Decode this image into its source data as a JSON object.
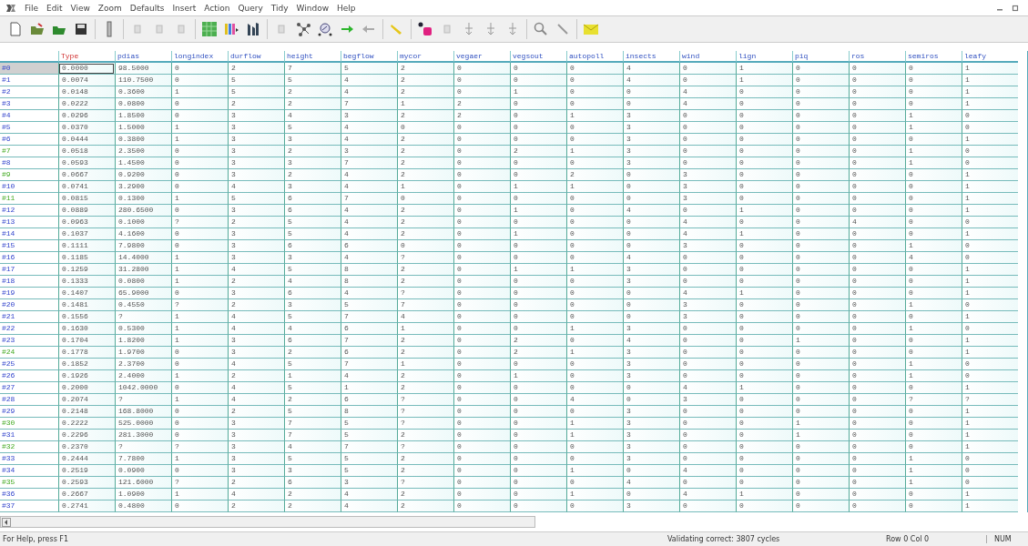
{
  "menu": [
    "File",
    "Edit",
    "View",
    "Zoom",
    "Defaults",
    "Insert",
    "Action",
    "Query",
    "Tidy",
    "Window",
    "Help"
  ],
  "table": {
    "columns": [
      {
        "label": "Type",
        "kind": "class"
      },
      {
        "label": "pdias",
        "kind": "variable"
      },
      {
        "label": "longindex",
        "kind": "variable"
      },
      {
        "label": "durflow",
        "kind": "variable"
      },
      {
        "label": "height",
        "kind": "variable"
      },
      {
        "label": "begflow",
        "kind": "variable"
      },
      {
        "label": "mycor",
        "kind": "variable"
      },
      {
        "label": "vegaer",
        "kind": "variable"
      },
      {
        "label": "vegsout",
        "kind": "variable"
      },
      {
        "label": "autopoll",
        "kind": "variable"
      },
      {
        "label": "insects",
        "kind": "variable"
      },
      {
        "label": "wind",
        "kind": "variable"
      },
      {
        "label": "lign",
        "kind": "variable"
      },
      {
        "label": "piq",
        "kind": "variable"
      },
      {
        "label": "ros",
        "kind": "variable"
      },
      {
        "label": "semiros",
        "kind": "variable"
      },
      {
        "label": "leafy",
        "kind": "variable"
      }
    ],
    "rows": [
      {
        "label": "#0",
        "kind": "primary",
        "selected": true,
        "cells": [
          "0.0000",
          "98.5000",
          "0",
          "2",
          "7",
          "5",
          "2",
          "0",
          "0",
          "0",
          "4",
          "0",
          "1",
          "0",
          "0",
          "0",
          "1"
        ]
      },
      {
        "label": "#1",
        "kind": "primary",
        "selected": false,
        "cells": [
          "0.0074",
          "110.7500",
          "0",
          "5",
          "5",
          "4",
          "2",
          "0",
          "0",
          "0",
          "4",
          "0",
          "1",
          "0",
          "0",
          "0",
          "1"
        ]
      },
      {
        "label": "#2",
        "kind": "primary",
        "selected": false,
        "cells": [
          "0.0148",
          "0.3600",
          "1",
          "5",
          "2",
          "4",
          "2",
          "0",
          "1",
          "0",
          "0",
          "4",
          "0",
          "0",
          "0",
          "0",
          "1"
        ]
      },
      {
        "label": "#3",
        "kind": "primary",
        "selected": false,
        "cells": [
          "0.0222",
          "0.0800",
          "0",
          "2",
          "2",
          "7",
          "1",
          "2",
          "0",
          "0",
          "0",
          "4",
          "0",
          "0",
          "0",
          "0",
          "1"
        ]
      },
      {
        "label": "#4",
        "kind": "primary",
        "selected": false,
        "cells": [
          "0.0296",
          "1.8500",
          "0",
          "3",
          "4",
          "3",
          "2",
          "2",
          "0",
          "1",
          "3",
          "0",
          "0",
          "0",
          "0",
          "1",
          "0"
        ]
      },
      {
        "label": "#5",
        "kind": "primary",
        "selected": false,
        "cells": [
          "0.0370",
          "1.5000",
          "1",
          "3",
          "5",
          "4",
          "0",
          "0",
          "0",
          "0",
          "3",
          "0",
          "0",
          "0",
          "0",
          "1",
          "0"
        ]
      },
      {
        "label": "#6",
        "kind": "primary",
        "selected": false,
        "cells": [
          "0.0444",
          "0.3800",
          "1",
          "3",
          "3",
          "4",
          "2",
          "0",
          "0",
          "0",
          "3",
          "0",
          "0",
          "0",
          "0",
          "0",
          "1"
        ]
      },
      {
        "label": "#7",
        "kind": "secondary",
        "selected": false,
        "cells": [
          "0.0518",
          "2.3500",
          "0",
          "3",
          "2",
          "3",
          "2",
          "0",
          "2",
          "1",
          "3",
          "0",
          "0",
          "0",
          "0",
          "1",
          "0"
        ]
      },
      {
        "label": "#8",
        "kind": "primary",
        "selected": false,
        "cells": [
          "0.0593",
          "1.4500",
          "0",
          "3",
          "3",
          "7",
          "2",
          "0",
          "0",
          "0",
          "3",
          "0",
          "0",
          "0",
          "0",
          "1",
          "0"
        ]
      },
      {
        "label": "#9",
        "kind": "secondary",
        "selected": false,
        "cells": [
          "0.0667",
          "0.9200",
          "0",
          "3",
          "2",
          "4",
          "2",
          "0",
          "0",
          "2",
          "0",
          "3",
          "0",
          "0",
          "0",
          "0",
          "1"
        ]
      },
      {
        "label": "#10",
        "kind": "primary",
        "selected": false,
        "cells": [
          "0.0741",
          "3.2900",
          "0",
          "4",
          "3",
          "4",
          "1",
          "0",
          "1",
          "1",
          "0",
          "3",
          "0",
          "0",
          "0",
          "0",
          "1"
        ]
      },
      {
        "label": "#11",
        "kind": "secondary",
        "selected": false,
        "cells": [
          "0.0815",
          "0.1300",
          "1",
          "5",
          "6",
          "7",
          "0",
          "0",
          "0",
          "0",
          "0",
          "3",
          "0",
          "0",
          "0",
          "0",
          "1"
        ]
      },
      {
        "label": "#12",
        "kind": "primary",
        "selected": false,
        "cells": [
          "0.0889",
          "280.6500",
          "0",
          "3",
          "6",
          "4",
          "2",
          "0",
          "1",
          "0",
          "4",
          "0",
          "1",
          "0",
          "0",
          "0",
          "1"
        ]
      },
      {
        "label": "#13",
        "kind": "primary",
        "selected": false,
        "cells": [
          "0.0963",
          "0.1000",
          "?",
          "2",
          "5",
          "4",
          "2",
          "0",
          "0",
          "0",
          "0",
          "4",
          "0",
          "0",
          "4",
          "0",
          "0"
        ]
      },
      {
        "label": "#14",
        "kind": "primary",
        "selected": false,
        "cells": [
          "0.1037",
          "4.1600",
          "0",
          "3",
          "5",
          "4",
          "2",
          "0",
          "1",
          "0",
          "0",
          "4",
          "1",
          "0",
          "0",
          "0",
          "1"
        ]
      },
      {
        "label": "#15",
        "kind": "primary",
        "selected": false,
        "cells": [
          "0.1111",
          "7.9800",
          "0",
          "3",
          "6",
          "6",
          "0",
          "0",
          "0",
          "0",
          "0",
          "3",
          "0",
          "0",
          "0",
          "1",
          "0"
        ]
      },
      {
        "label": "#16",
        "kind": "primary",
        "selected": false,
        "cells": [
          "0.1185",
          "14.4000",
          "1",
          "3",
          "3",
          "4",
          "?",
          "0",
          "0",
          "0",
          "4",
          "0",
          "0",
          "0",
          "0",
          "4",
          "0"
        ]
      },
      {
        "label": "#17",
        "kind": "primary",
        "selected": false,
        "cells": [
          "0.1259",
          "31.2800",
          "1",
          "4",
          "5",
          "8",
          "2",
          "0",
          "1",
          "1",
          "3",
          "0",
          "0",
          "0",
          "0",
          "0",
          "1"
        ]
      },
      {
        "label": "#18",
        "kind": "primary",
        "selected": false,
        "cells": [
          "0.1333",
          "0.0800",
          "1",
          "2",
          "4",
          "8",
          "2",
          "0",
          "0",
          "0",
          "3",
          "0",
          "0",
          "0",
          "0",
          "0",
          "1"
        ]
      },
      {
        "label": "#19",
        "kind": "primary",
        "selected": false,
        "cells": [
          "0.1407",
          "65.9000",
          "0",
          "3",
          "6",
          "4",
          "?",
          "0",
          "0",
          "0",
          "0",
          "4",
          "1",
          "0",
          "0",
          "0",
          "1"
        ]
      },
      {
        "label": "#20",
        "kind": "primary",
        "selected": false,
        "cells": [
          "0.1481",
          "0.4550",
          "?",
          "2",
          "3",
          "5",
          "7",
          "0",
          "0",
          "0",
          "0",
          "3",
          "0",
          "0",
          "0",
          "1",
          "0"
        ]
      },
      {
        "label": "#21",
        "kind": "primary",
        "selected": false,
        "cells": [
          "0.1556",
          "?",
          "1",
          "4",
          "5",
          "7",
          "4",
          "0",
          "0",
          "0",
          "0",
          "3",
          "0",
          "0",
          "0",
          "0",
          "1"
        ]
      },
      {
        "label": "#22",
        "kind": "primary",
        "selected": false,
        "cells": [
          "0.1630",
          "0.5300",
          "1",
          "4",
          "4",
          "6",
          "1",
          "0",
          "0",
          "1",
          "3",
          "0",
          "0",
          "0",
          "0",
          "1",
          "0"
        ]
      },
      {
        "label": "#23",
        "kind": "primary",
        "selected": false,
        "cells": [
          "0.1704",
          "1.8200",
          "1",
          "3",
          "6",
          "7",
          "2",
          "0",
          "2",
          "0",
          "4",
          "0",
          "0",
          "1",
          "0",
          "0",
          "1"
        ]
      },
      {
        "label": "#24",
        "kind": "secondary",
        "selected": false,
        "cells": [
          "0.1778",
          "1.9700",
          "0",
          "3",
          "2",
          "6",
          "2",
          "0",
          "2",
          "1",
          "3",
          "0",
          "0",
          "0",
          "0",
          "0",
          "1"
        ]
      },
      {
        "label": "#25",
        "kind": "primary",
        "selected": false,
        "cells": [
          "0.1852",
          "2.3700",
          "0",
          "4",
          "5",
          "7",
          "1",
          "0",
          "0",
          "0",
          "3",
          "0",
          "0",
          "0",
          "0",
          "1",
          "0"
        ]
      },
      {
        "label": "#26",
        "kind": "primary",
        "selected": false,
        "cells": [
          "0.1926",
          "2.4000",
          "1",
          "2",
          "1",
          "4",
          "2",
          "0",
          "1",
          "0",
          "3",
          "0",
          "0",
          "0",
          "0",
          "1",
          "0"
        ]
      },
      {
        "label": "#27",
        "kind": "primary",
        "selected": false,
        "cells": [
          "0.2000",
          "1042.0000",
          "0",
          "4",
          "5",
          "1",
          "2",
          "0",
          "0",
          "0",
          "0",
          "4",
          "1",
          "0",
          "0",
          "0",
          "1"
        ]
      },
      {
        "label": "#28",
        "kind": "primary",
        "selected": false,
        "cells": [
          "0.2074",
          "?",
          "1",
          "4",
          "2",
          "6",
          "?",
          "0",
          "0",
          "4",
          "0",
          "3",
          "0",
          "0",
          "0",
          "?",
          "?"
        ]
      },
      {
        "label": "#29",
        "kind": "primary",
        "selected": false,
        "cells": [
          "0.2148",
          "168.8000",
          "0",
          "2",
          "5",
          "8",
          "?",
          "0",
          "0",
          "0",
          "3",
          "0",
          "0",
          "0",
          "0",
          "0",
          "1"
        ]
      },
      {
        "label": "#30",
        "kind": "secondary",
        "selected": false,
        "cells": [
          "0.2222",
          "525.0000",
          "0",
          "3",
          "7",
          "5",
          "?",
          "0",
          "0",
          "1",
          "3",
          "0",
          "0",
          "1",
          "0",
          "0",
          "1"
        ]
      },
      {
        "label": "#31",
        "kind": "primary",
        "selected": false,
        "cells": [
          "0.2296",
          "281.3000",
          "0",
          "3",
          "7",
          "5",
          "2",
          "0",
          "0",
          "1",
          "3",
          "0",
          "0",
          "1",
          "0",
          "0",
          "1"
        ]
      },
      {
        "label": "#32",
        "kind": "secondary",
        "selected": false,
        "cells": [
          "0.2370",
          "?",
          "?",
          "3",
          "4",
          "7",
          "?",
          "0",
          "0",
          "0",
          "3",
          "0",
          "0",
          "0",
          "0",
          "0",
          "1"
        ]
      },
      {
        "label": "#33",
        "kind": "primary",
        "selected": false,
        "cells": [
          "0.2444",
          "7.7800",
          "1",
          "3",
          "5",
          "5",
          "2",
          "0",
          "0",
          "0",
          "3",
          "0",
          "0",
          "0",
          "0",
          "1",
          "0"
        ]
      },
      {
        "label": "#34",
        "kind": "primary",
        "selected": false,
        "cells": [
          "0.2519",
          "0.0900",
          "0",
          "3",
          "3",
          "5",
          "2",
          "0",
          "0",
          "1",
          "0",
          "4",
          "0",
          "0",
          "0",
          "1",
          "0"
        ]
      },
      {
        "label": "#35",
        "kind": "secondary",
        "selected": false,
        "cells": [
          "0.2593",
          "121.6000",
          "?",
          "2",
          "6",
          "3",
          "?",
          "0",
          "0",
          "0",
          "4",
          "0",
          "0",
          "0",
          "0",
          "1",
          "0"
        ]
      },
      {
        "label": "#36",
        "kind": "primary",
        "selected": false,
        "cells": [
          "0.2667",
          "1.0900",
          "1",
          "4",
          "2",
          "4",
          "2",
          "0",
          "0",
          "1",
          "0",
          "4",
          "1",
          "0",
          "0",
          "0",
          "1"
        ]
      },
      {
        "label": "#37",
        "kind": "primary",
        "selected": false,
        "cells": [
          "0.2741",
          "0.4800",
          "0",
          "2",
          "2",
          "4",
          "2",
          "0",
          "0",
          "0",
          "3",
          "0",
          "0",
          "0",
          "0",
          "0",
          "1"
        ]
      }
    ]
  },
  "status_bar": {
    "help": "For Help, press F1",
    "message": "Validating correct: 3807 cycles",
    "position": "Row 0  Col 0",
    "num": "NUM"
  }
}
